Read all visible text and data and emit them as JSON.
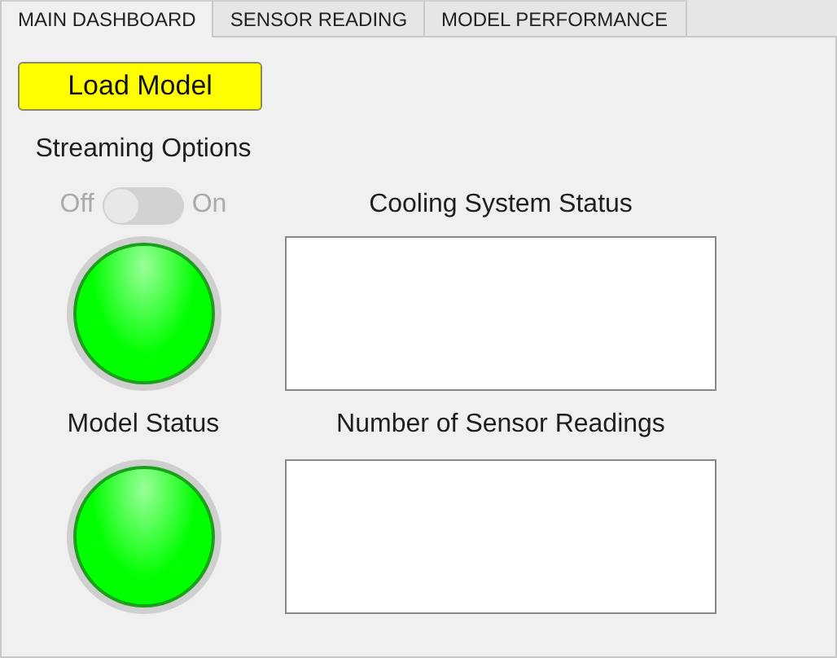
{
  "tabs": [
    {
      "label": "MAIN DASHBOARD",
      "selected": true
    },
    {
      "label": "SENSOR READING",
      "selected": false
    },
    {
      "label": "MODEL PERFORMANCE",
      "selected": false
    }
  ],
  "load_button": {
    "label": "Load Model"
  },
  "streaming": {
    "title": "Streaming Options",
    "off_label": "Off",
    "on_label": "On",
    "on": false,
    "disabled": true
  },
  "cooling_lamp": {
    "color": "#00ff00"
  },
  "cooling_status": {
    "label": "Cooling System Status"
  },
  "model_status": {
    "label": "Model Status",
    "color": "#00ff00"
  },
  "sensor_readings": {
    "label": "Number of Sensor Readings"
  }
}
